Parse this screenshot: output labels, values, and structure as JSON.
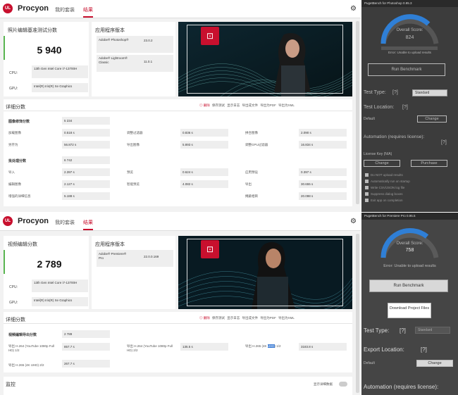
{
  "win1": {
    "app_name": "Procyon",
    "nav": [
      "我的套装",
      "结果"
    ],
    "score_title": "照片编辑基准测试分数",
    "score": "5 940",
    "cpu_label": "CPU:",
    "cpu_value": "13th Gen Intel Core i7-13700H",
    "gpu_label": "GPU:",
    "gpu_value": "Intel(R) Iris(R) Xe Graphics",
    "app_version_title": "应用程序版本",
    "apps": [
      {
        "name": "Adobe® Photoshop®",
        "version": "23.0.2"
      },
      {
        "name": "Adobe® Lightroom® Classic",
        "version": "11.0.1"
      }
    ],
    "details_title": "详细分数",
    "actions": [
      "◎ 删除",
      "保存测试",
      "显示日志",
      "导出成文件",
      "导出为PDF",
      "导出为XML"
    ],
    "sections": [
      {
        "label": "图像修饰分数",
        "value": "5 234",
        "rows": [
          [
            "加载图像",
            "0.518 s",
            "调整过滤器",
            "0.836 s",
            "拼合图像",
            "2.090 s"
          ],
          [
            "另存为",
            "56.872 s",
            "导出图像",
            "5.893 s",
            "调整GPU过滤器",
            "16.834 s"
          ]
        ]
      },
      {
        "label": "批处理分数",
        "value": "6 742",
        "rows": [
          [
            "导入",
            "2.397 s",
            "预览",
            "0.624 s",
            "应用预设",
            "0.397 s"
          ],
          [
            "编辑图像",
            "2.127 s",
            "智能预览",
            "4.082 s",
            "导出",
            "30.655 s"
          ],
          [
            "增强的详细信息",
            "5.188 s",
            "",
            "",
            "掩蔽相目",
            "20.098 s"
          ]
        ]
      }
    ]
  },
  "win2": {
    "app_name": "Procyon",
    "nav": [
      "我的套装",
      "结果"
    ],
    "score_title": "视频编辑分数",
    "score": "2 789",
    "cpu_label": "CPU:",
    "cpu_value": "13th Gen Intel Core i7-13700H",
    "gpu_label": "GPU:",
    "gpu_value": "Intel(R) Iris(R) Xe Graphics",
    "app_version_title": "应用程序版本",
    "apps": [
      {
        "name": "Adobe® Premiere® Pro",
        "version": "22.0.0.169"
      }
    ],
    "details_title": "详细分数",
    "actions": [
      "◎ 删除",
      "保存测试",
      "显示日志",
      "导出成文件",
      "导出为PDF",
      "导出为XML"
    ],
    "section_label": "视频编辑导出分数",
    "section_value": "2 789",
    "rows": [
      {
        "label": "导出 H.264 (YouTube 1080p Full HD) 1/2",
        "value": "857.7 s"
      },
      {
        "label": "导出 H.264 (YouTube 1080p Full HD) 2/2",
        "value": "135.5 s"
      },
      {
        "label_pre": "导出 H.265 (4K ",
        "label_hl": "UHD",
        "label_post": ") 1/2",
        "value": "3183.8 s"
      },
      {
        "label": "导出 H.265 (4K UHD) 2/2",
        "value": "267.7 s"
      }
    ],
    "monitor_title": "监控",
    "monitor_toggle": "显示详细数据"
  },
  "ps_panel": {
    "title": "PugetBench for Photoshop 0.95.3",
    "gauge_label": "Overall Score:",
    "gauge_value": "824",
    "error": "Error: Unable to upload results",
    "run": "Run Benchmark",
    "test_type_label": "Test Type:",
    "help": "[?]",
    "test_type": "Standard",
    "test_location_label": "Test Location:",
    "default": "Default",
    "change": "Change",
    "automation": "Automation (requires license):",
    "license_key": "License Key (N/A)",
    "purchase": "Purchase",
    "options": [
      "Do NOT upload results",
      "Automatically run on startup",
      "Write CSV/JSON log file",
      "Suppress dialog boxes",
      "Exit app on completion"
    ]
  },
  "pr_panel": {
    "title": "PugetBench for Premiere Pro 0.95.5",
    "gauge_label": "Overall Score:",
    "gauge_value": "758",
    "error": "Error: Unable to upload results",
    "run": "Run Benchmark",
    "download": "Download Project Files",
    "test_type_label": "Test Type:",
    "help": "[?]",
    "test_type": "Standard",
    "export_location_label": "Export Location:",
    "default": "Default",
    "change": "Change",
    "automation": "Automation (requires license):"
  },
  "colors": {
    "accent": "#c8102e",
    "score_bar": "#5ab550",
    "gauge": "#2f7fd6"
  }
}
